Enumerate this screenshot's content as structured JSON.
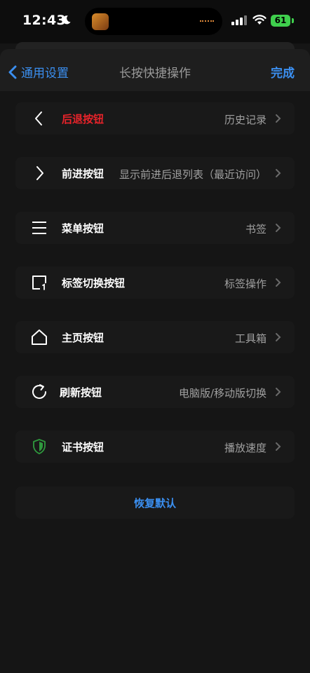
{
  "status_bar": {
    "time": "12:43",
    "battery": "61",
    "icons": [
      "moon-icon",
      "cellular-signal-icon",
      "wifi-icon",
      "battery-icon"
    ]
  },
  "nav": {
    "back_label": "通用设置",
    "title": "长按快捷操作",
    "done_label": "完成"
  },
  "rows": [
    {
      "label": "后退按钮",
      "value": "历史记录",
      "icon": "back-arrow-icon"
    },
    {
      "label": "前进按钮",
      "value": "显示前进后退列表（最近访问）",
      "icon": "forward-arrow-icon"
    },
    {
      "label": "菜单按钮",
      "value": "书签",
      "icon": "menu-icon"
    },
    {
      "label": "标签切换按钮",
      "value": "标签操作",
      "icon": "tabs-icon"
    },
    {
      "label": "主页按钮",
      "value": "工具箱",
      "icon": "home-icon"
    },
    {
      "label": "刷新按钮",
      "value": "电脑版/移动版切换",
      "icon": "refresh-icon"
    },
    {
      "label": "证书按钮",
      "value": "播放速度",
      "icon": "shield-icon"
    }
  ],
  "reset_label": "恢复默认",
  "colors": {
    "accent": "#3b8ff0",
    "highlight_red": "#e8232a",
    "background": "#151515",
    "row_background": "#191919"
  }
}
